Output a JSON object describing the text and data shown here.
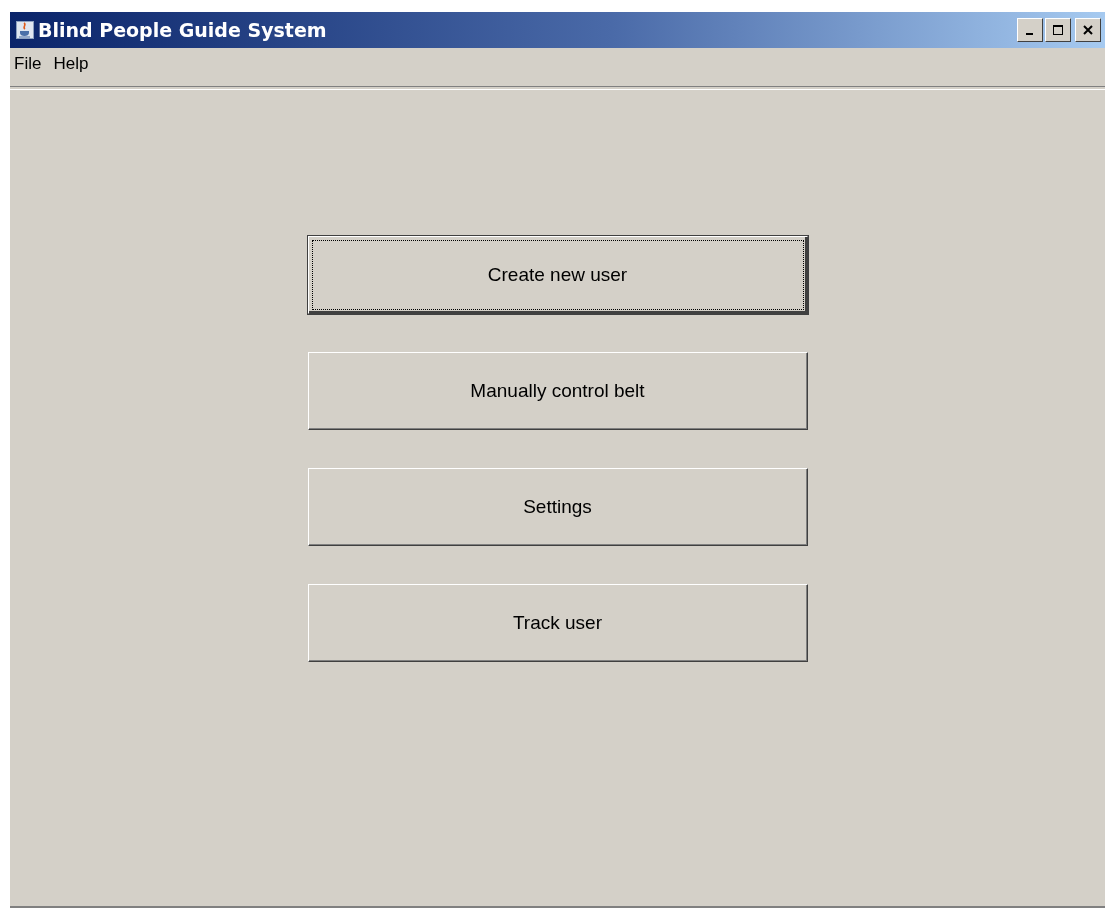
{
  "window": {
    "title": "Blind People Guide System"
  },
  "menu": [
    "File",
    "Help"
  ],
  "buttons": [
    {
      "label": "Create new user",
      "focused": true
    },
    {
      "label": "Manually control belt",
      "focused": false
    },
    {
      "label": "Settings",
      "focused": false
    },
    {
      "label": "Track user",
      "focused": false
    }
  ]
}
